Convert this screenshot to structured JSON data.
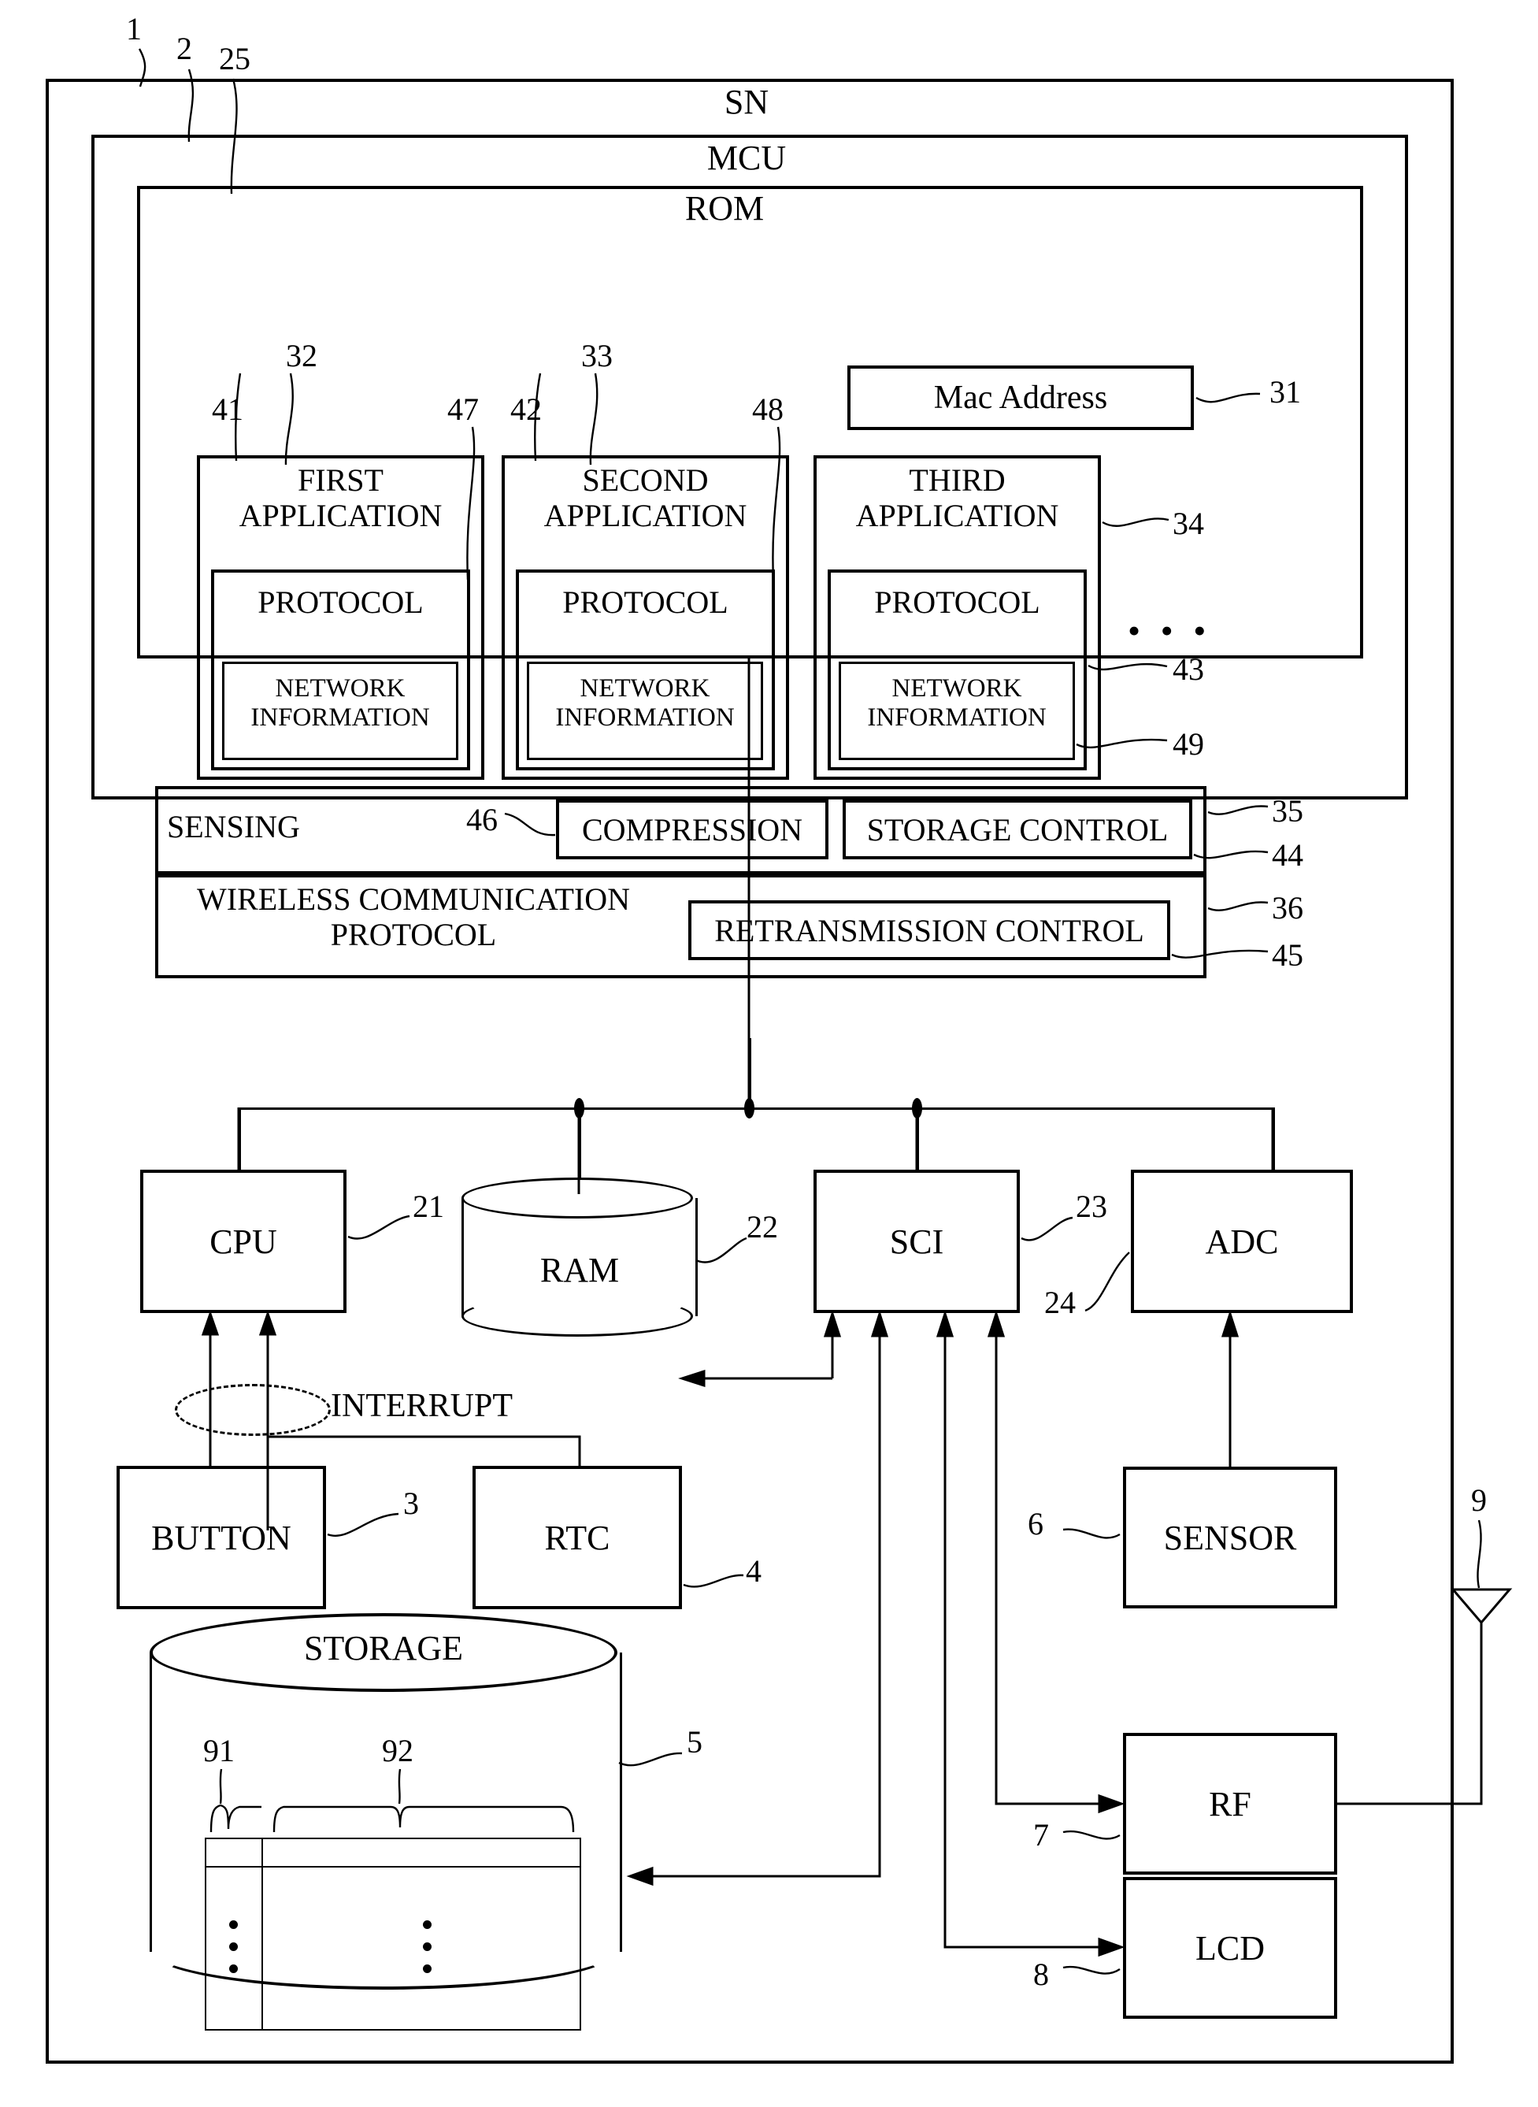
{
  "figure": {
    "outer": {
      "label": "SN",
      "ref": "1"
    },
    "mcu": {
      "label": "MCU",
      "ref": "2"
    },
    "rom": {
      "label": "ROM",
      "ref": "25"
    },
    "mac_address": {
      "label": "Mac Address",
      "ref": "31"
    },
    "applications": [
      {
        "title": "FIRST\nAPPLICATION",
        "app_ref": "32",
        "app_ref_left": "41",
        "protocol": "PROTOCOL",
        "protocol_ref": "47",
        "network_info": "NETWORK\nINFORMATION"
      },
      {
        "title": "SECOND\nAPPLICATION",
        "app_ref": "33",
        "app_ref_left": "42",
        "protocol": "PROTOCOL",
        "protocol_ref": "48",
        "network_info": "NETWORK\nINFORMATION"
      },
      {
        "title": "THIRD\nAPPLICATION",
        "app_ref": "34",
        "app_ref_left": "",
        "protocol": "PROTOCOL",
        "protocol_ref": "43",
        "network_info": "NETWORK\nINFORMATION",
        "network_info_ref": "49"
      }
    ],
    "app_ellipsis": "• • •",
    "sensing_row": {
      "label": "SENSING",
      "ref": "35",
      "compression": {
        "label": "COMPRESSION",
        "ref": "46"
      },
      "storage_control": {
        "label": "STORAGE CONTROL",
        "ref": "44"
      }
    },
    "wireless_row": {
      "label": "WIRELESS COMMUNICATION\nPROTOCOL",
      "ref": "36",
      "retransmission_control": {
        "label": "RETRANSMISSION CONTROL",
        "ref": "45"
      }
    },
    "cpu": {
      "label": "CPU",
      "ref": "21"
    },
    "ram": {
      "label": "RAM",
      "ref": "22"
    },
    "sci": {
      "label": "SCI",
      "ref": "23"
    },
    "adc": {
      "label": "ADC",
      "ref": "24"
    },
    "interrupt": {
      "label": "INTERRUPT"
    },
    "button": {
      "label": "BUTTON",
      "ref": "3"
    },
    "rtc": {
      "label": "RTC",
      "ref": "4"
    },
    "storage": {
      "label": "STORAGE",
      "ref": "5",
      "col1_ref": "91",
      "col2_ref": "92"
    },
    "sensor": {
      "label": "SENSOR",
      "ref": "6"
    },
    "rf": {
      "label": "RF",
      "ref": "7"
    },
    "lcd": {
      "label": "LCD",
      "ref": "8"
    },
    "antenna": {
      "ref": "9"
    }
  }
}
